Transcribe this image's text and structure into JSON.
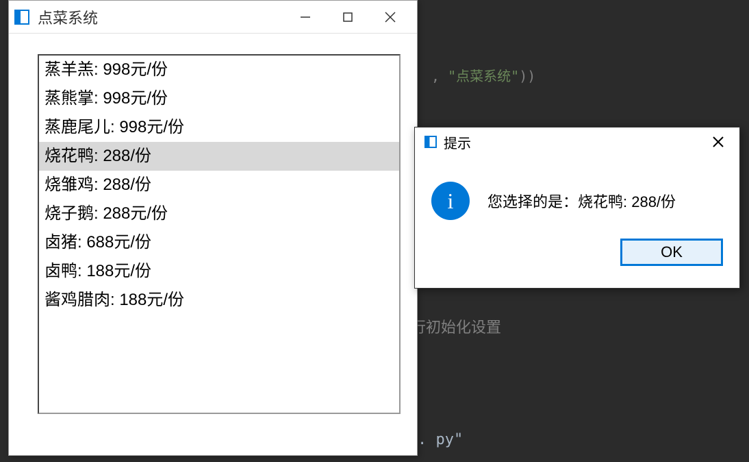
{
  "main_window": {
    "title": "点菜系统",
    "list_items": [
      "蒸羊羔: 998元/份",
      "蒸熊掌: 998元/份",
      "蒸鹿尾儿: 998元/份",
      "烧花鸭: 288/份",
      "烧雏鸡: 288/份",
      "烧子鹅: 288元/份",
      "卤猪: 688元/份",
      "卤鸭: 188元/份",
      "酱鸡腊肉: 188元/份"
    ],
    "selected_index": 3
  },
  "dialog": {
    "title": "提示",
    "message": "您选择的是：烧花鸭: 288/份",
    "ok_label": "OK",
    "info_glyph": "i"
  },
  "background": {
    "code_line_1_prefix": ", ",
    "code_line_1_string": "\"点菜系统\"",
    "code_line_1_suffix": "))",
    "code_line_2": "行初始化设置",
    "code_line_3": ". py\""
  }
}
